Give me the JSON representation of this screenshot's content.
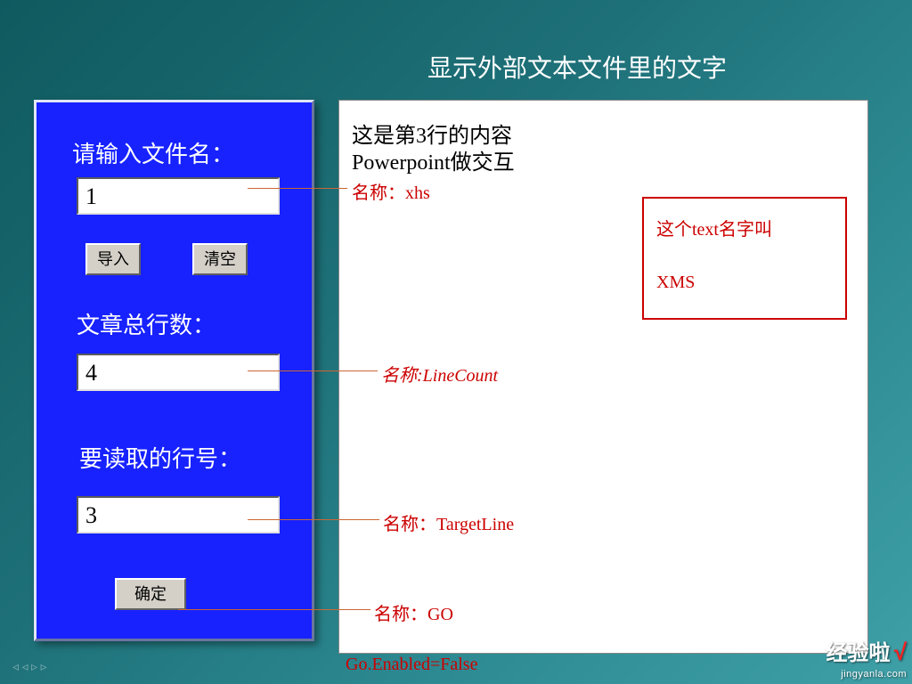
{
  "title": "显示外部文本文件里的文字",
  "panel": {
    "label_filename": "请输入文件名：",
    "input_filename": "1",
    "btn_import": "导入",
    "btn_clear": "清空",
    "label_linecount": "文章总行数：",
    "input_linecount": "4",
    "label_targetline": "要读取的行号：",
    "input_targetline": "3",
    "btn_ok": "确定"
  },
  "display": {
    "content_line1": "这是第3行的内容",
    "content_line2": "Powerpoint做交互",
    "infobox_line1": "这个text名字叫",
    "infobox_line2": "XMS"
  },
  "annotations": {
    "xhs": "名称：xhs",
    "linecount": "名称:LineCount",
    "targetline": "名称：TargetLine",
    "go": "名称：GO",
    "go_enabled": "Go.Enabled=False"
  },
  "watermark": {
    "brand": "经验啦",
    "check": "√",
    "url": "jingyanla.com"
  },
  "nav_arrows": "◃ ◃ ▹ ▹"
}
